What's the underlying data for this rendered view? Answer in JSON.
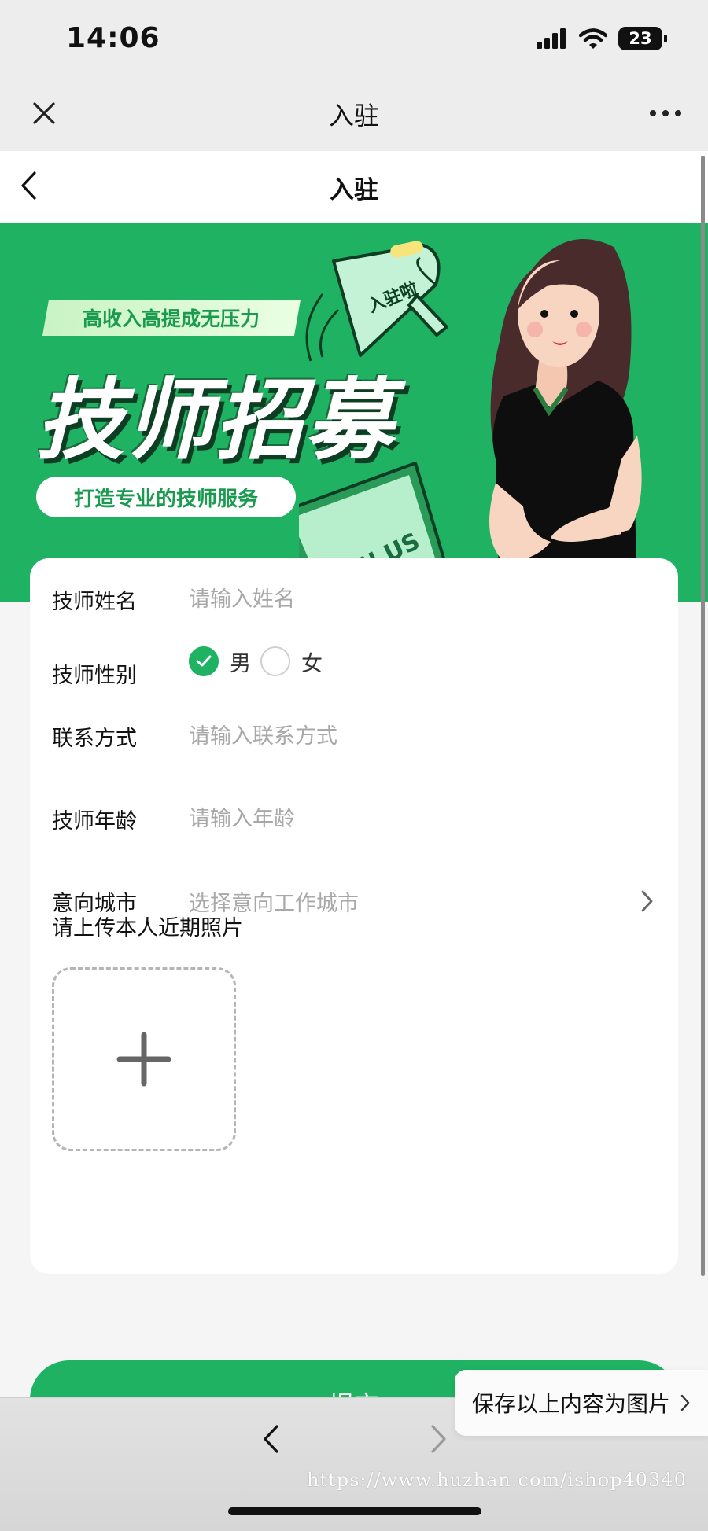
{
  "status_bar": {
    "time": "14:06",
    "battery": "23",
    "icons": [
      "signal-icon",
      "wifi-icon",
      "battery-icon"
    ]
  },
  "wx_nav": {
    "title": "入驻",
    "close_icon": "close-icon",
    "more_icon": "more-icon"
  },
  "page": {
    "title": "入驻",
    "back_icon": "back-icon"
  },
  "banner": {
    "tag": "高收入高提成无压力",
    "title": "技师招募",
    "subtitle": "打造专业的技师服务",
    "megaphone_text": "入驻啦",
    "flyer_text": "JOIN US",
    "colors": {
      "background": "#1fb262"
    }
  },
  "form": {
    "name": {
      "label": "技师姓名",
      "placeholder": "请输入姓名",
      "value": ""
    },
    "gender": {
      "label": "技师性别",
      "options": [
        {
          "label": "男",
          "checked": true
        },
        {
          "label": "女",
          "checked": false
        }
      ]
    },
    "phone": {
      "label": "联系方式",
      "placeholder": "请输入联系方式",
      "value": ""
    },
    "age": {
      "label": "技师年龄",
      "placeholder": "请输入年龄",
      "value": ""
    },
    "city": {
      "label": "意向城市",
      "placeholder": "选择意向工作城市"
    },
    "upload": {
      "label": "请上传本人近期照片",
      "icon": "plus-icon"
    }
  },
  "submit_label": "提交",
  "save_image": {
    "label": "保存以上内容为图片"
  },
  "watermark": "https://www.huzhan.com/ishop40340",
  "colors": {
    "accent": "#1fb262"
  }
}
